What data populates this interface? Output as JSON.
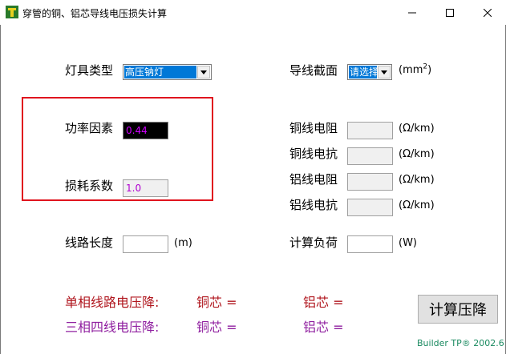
{
  "window": {
    "title": "穿管的铜、铝芯导线电压损失计算"
  },
  "left": {
    "lamp_type_label": "灯具类型",
    "lamp_type_value": "高压钠灯",
    "power_factor_label": "功率因素",
    "power_factor_value": "0.44",
    "loss_coef_label": "损耗系数",
    "loss_coef_value": "1.0",
    "line_length_label": "线路长度",
    "line_length_unit": "(m)",
    "line_length_value": ""
  },
  "right": {
    "section_label": "导线截面",
    "section_value": "请选择",
    "section_unit_prefix": "(mm",
    "section_unit_sup": "2",
    "section_unit_suffix": ")",
    "rows": [
      {
        "label": "铜线电阻",
        "unit": "(Ω/km)",
        "value": ""
      },
      {
        "label": "铜线电抗",
        "unit": "(Ω/km)",
        "value": ""
      },
      {
        "label": "铝线电阻",
        "unit": "(Ω/km)",
        "value": ""
      },
      {
        "label": "铝线电抗",
        "unit": "(Ω/km)",
        "value": ""
      }
    ],
    "load_label": "计算负荷",
    "load_unit": "(W)",
    "load_value": ""
  },
  "results": {
    "single_phase_label": "单相线路电压降:",
    "three_phase_label": "三相四线电压降:",
    "copper_label": "铜芯 =",
    "aluminum_label": "铝芯 ="
  },
  "buttons": {
    "calculate": "计算压降"
  },
  "footer": "Builder TP® 2002.6",
  "colors": {
    "highlight_box": "#e0141e",
    "single_phase_text": "#b0161e",
    "three_phase_text": "#9020a0",
    "power_factor_text": "#d000ff"
  }
}
